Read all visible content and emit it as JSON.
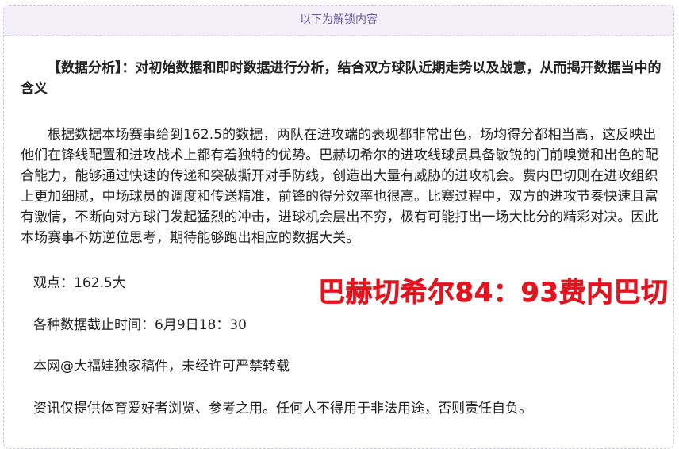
{
  "unlock_bar": {
    "label": "以下为解锁内容"
  },
  "article": {
    "heading": "【数据分析】：对初始数据和即时数据进行分析，结合双方球队近期走势以及战意，从而揭开数据当中的含义",
    "body": "根据数据本场赛事给到162.5的数据，两队在进攻端的表现都非常出色，场均得分都相当高，这反映出他们在锋线配置和进攻战术上都有着独特的优势。巴赫切希尔的进攻线球员具备敏锐的门前嗅觉和出色的配合能力，能够通过快速的传递和突破撕开对手防线，创造出大量有威胁的进攻机会。费内巴切则在进攻组织上更加细腻，中场球员的调度和传送精准，前锋的得分效率也很高。比赛过程中，双方的进攻节奏快速且富有激情，不断向对方球门发起猛烈的冲击，进球机会层出不穷，极有可能打出一场大比分的精彩对决。因此本场赛事不妨逆位思考，期待能够跑出相应的数据大关。",
    "viewpoint": "观点：162.5大",
    "cutoff": "各种数据截止时间：6月9日18：30",
    "copyright": "本网@大福娃独家稿件，未经许可严禁转载",
    "disclaimer": "资讯仅提供体育爱好者浏览、参考之用。任何人不得用于非法用途，否则责任自负。"
  },
  "score_overlay": "巴赫切希尔84：93费内巴切",
  "colors": {
    "accent": "#6a5a9c",
    "score": "#e2141f",
    "text": "#222222"
  }
}
